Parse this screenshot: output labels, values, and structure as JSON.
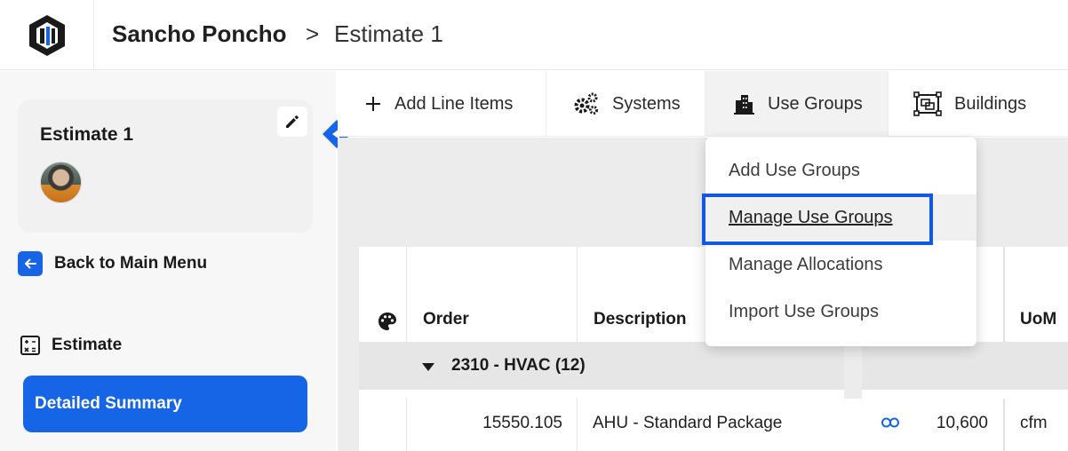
{
  "header": {
    "project_name": "Sancho Poncho",
    "separator": ">",
    "estimate_name": "Estimate 1"
  },
  "sidebar": {
    "estimate_card_title": "Estimate 1",
    "back_label": "Back to Main Menu",
    "section_label": "Estimate",
    "active_item_label": "Detailed Summary"
  },
  "toolbar": {
    "add_line_items": "Add Line Items",
    "systems": "Systems",
    "use_groups": "Use Groups",
    "buildings": "Buildings"
  },
  "use_groups_menu": {
    "items": [
      "Add Use Groups",
      "Manage Use Groups",
      "Manage Allocations",
      "Import Use Groups"
    ],
    "hovered_item": "Manage Use Groups"
  },
  "table": {
    "columns": [
      "",
      "Order",
      "Description",
      "",
      "UoM"
    ],
    "group_row": "2310 - HVAC (12)",
    "rows": [
      {
        "order": "15550.105",
        "description": "AHU - Standard Package",
        "quantity": "10,600",
        "uom": "cfm"
      }
    ]
  },
  "colors": {
    "accent": "#1565e6",
    "highlight_border": "#1158e6",
    "logo_dark": "#1a1a1a",
    "logo_blue": "#1565e6"
  },
  "icons": {
    "logo": "app-logo",
    "edit": "pencil-icon",
    "collapse": "chevron-left-icon",
    "back": "arrow-left-icon",
    "section": "calculator-icon",
    "add": "plus-icon",
    "systems": "gears-icon",
    "use_groups": "buildings-icon",
    "buildings": "floorplan-icon",
    "palette": "palette-icon",
    "group_toggle": "caret-down-icon",
    "link": "link-icon"
  }
}
